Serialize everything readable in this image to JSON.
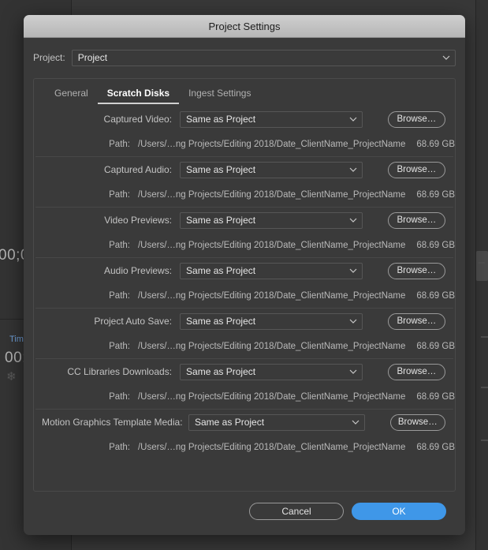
{
  "background": {
    "timecode_top": "00;0",
    "timeline_panel_label": "Tim",
    "timecode_bottom": "00;"
  },
  "dialog": {
    "title": "Project Settings",
    "project_row": {
      "label": "Project:",
      "value": "Project"
    },
    "tabs": [
      {
        "label": "General",
        "active": false
      },
      {
        "label": "Scratch Disks",
        "active": true
      },
      {
        "label": "Ingest Settings",
        "active": false
      }
    ],
    "path_label": "Path:",
    "browse_label": "Browse…",
    "scratch_disks": [
      {
        "label": "Captured Video:",
        "value": "Same as Project",
        "path": "/Users/…ng Projects/Editing 2018/Date_ClientName_ProjectName",
        "size": "68.69 GB"
      },
      {
        "label": "Captured Audio:",
        "value": "Same as Project",
        "path": "/Users/…ng Projects/Editing 2018/Date_ClientName_ProjectName",
        "size": "68.69 GB"
      },
      {
        "label": "Video Previews:",
        "value": "Same as Project",
        "path": "/Users/…ng Projects/Editing 2018/Date_ClientName_ProjectName",
        "size": "68.69 GB"
      },
      {
        "label": "Audio Previews:",
        "value": "Same as Project",
        "path": "/Users/…ng Projects/Editing 2018/Date_ClientName_ProjectName",
        "size": "68.69 GB"
      },
      {
        "label": "Project Auto Save:",
        "value": "Same as Project",
        "path": "/Users/…ng Projects/Editing 2018/Date_ClientName_ProjectName",
        "size": "68.69 GB"
      },
      {
        "label": "CC Libraries Downloads:",
        "value": "Same as Project",
        "path": "/Users/…ng Projects/Editing 2018/Date_ClientName_ProjectName",
        "size": "68.69 GB"
      },
      {
        "label": "Motion Graphics Template Media:",
        "value": "Same as Project",
        "path": "/Users/…ng Projects/Editing 2018/Date_ClientName_ProjectName",
        "size": "68.69 GB"
      }
    ],
    "footer": {
      "cancel_label": "Cancel",
      "ok_label": "OK"
    }
  },
  "colors": {
    "dialog_bg": "#3a3a3a",
    "titlebar": "#c4c4c4",
    "accent_ok": "#3f97e8",
    "panel_label_blue": "#6f9fd8"
  }
}
